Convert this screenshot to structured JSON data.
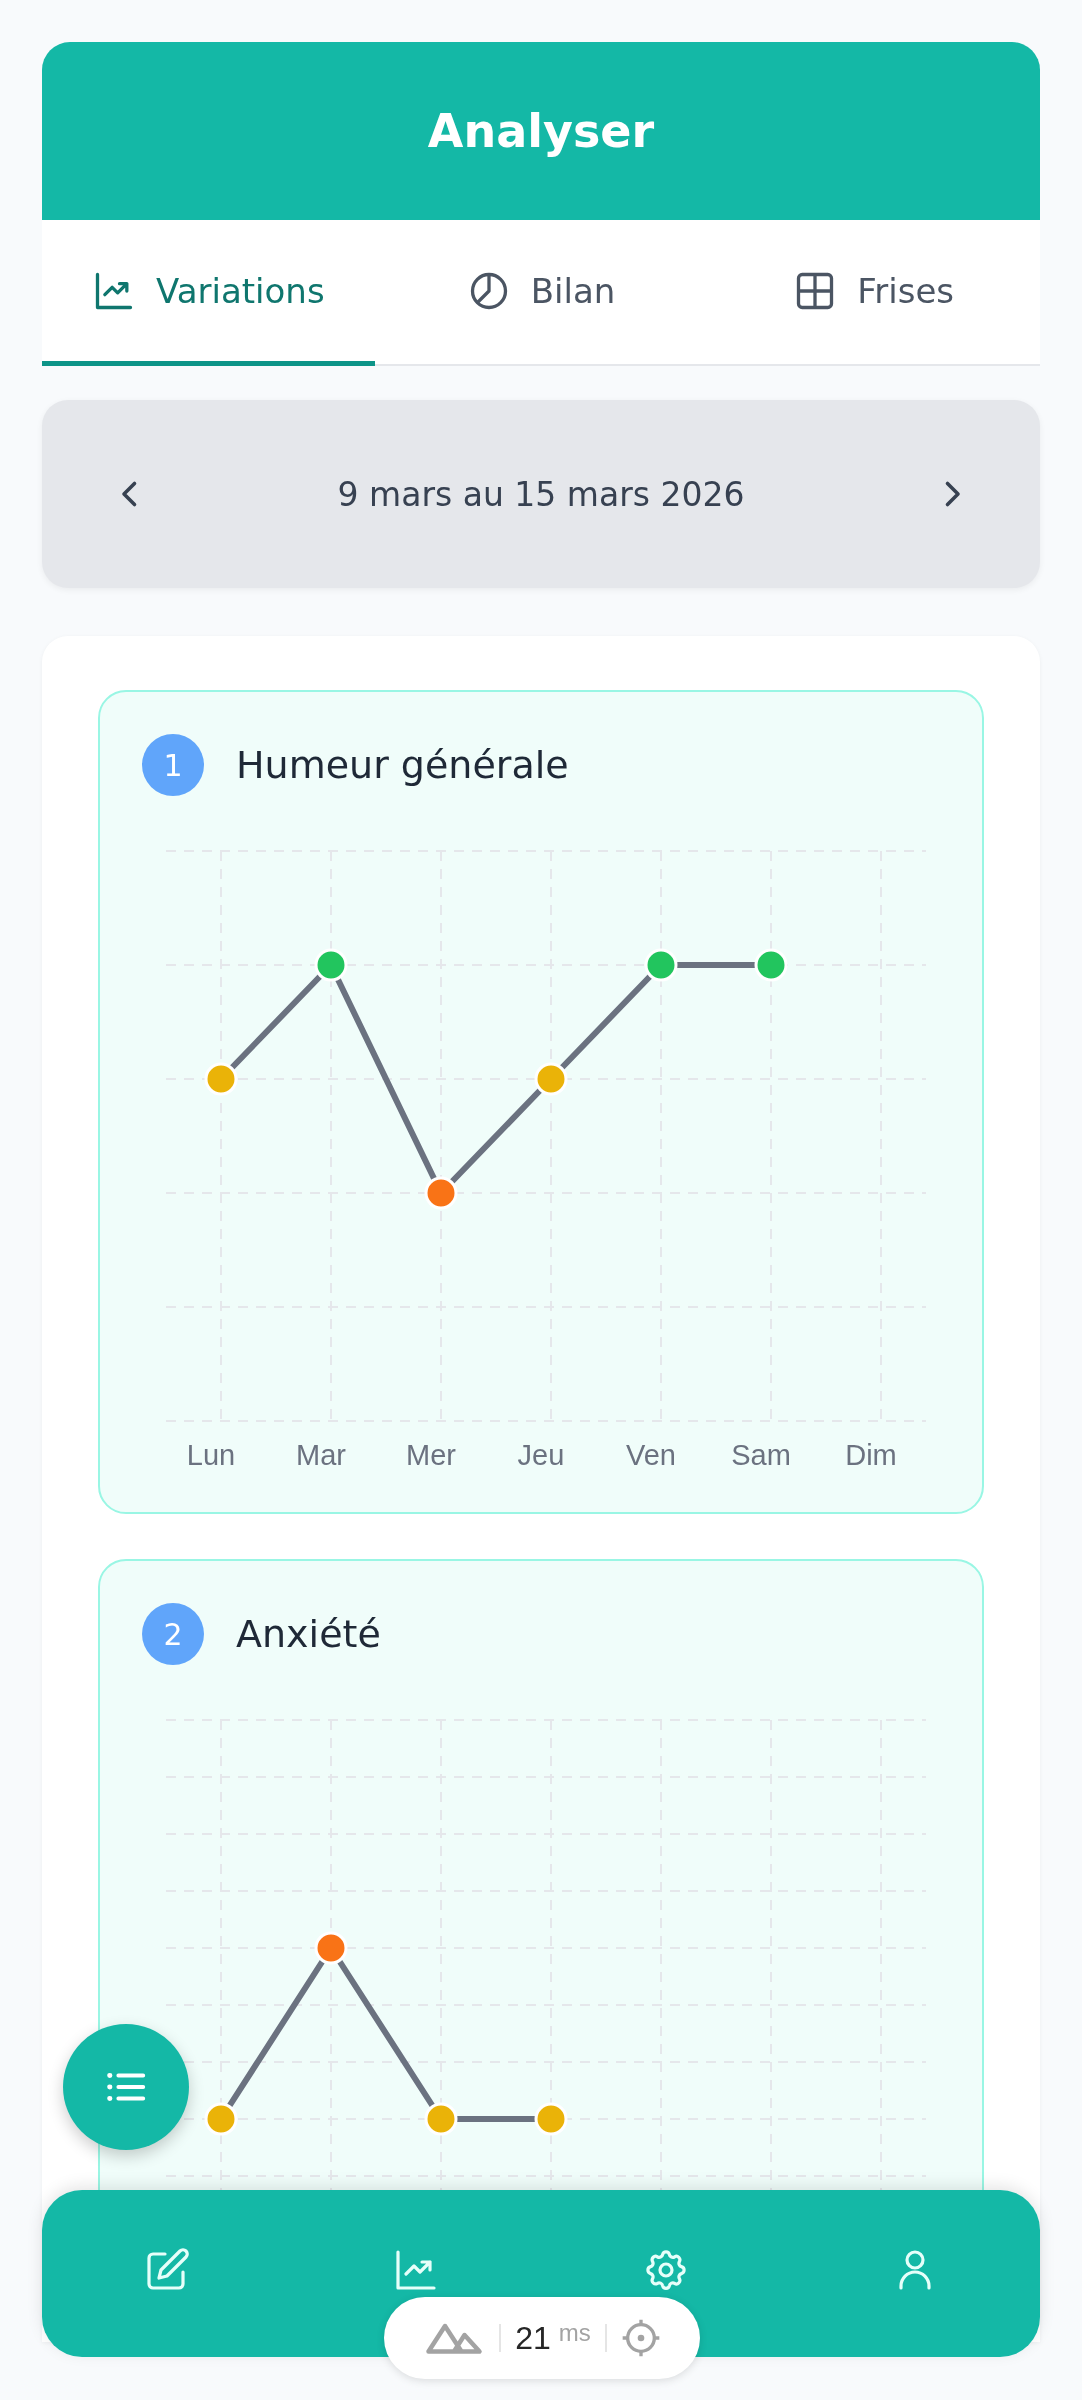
{
  "header": {
    "title": "Analyser"
  },
  "tabs": [
    {
      "label": "Variations",
      "selected": true
    },
    {
      "label": "Bilan",
      "selected": false
    },
    {
      "label": "Frises",
      "selected": false
    }
  ],
  "week": {
    "label": "9 mars au 15 mars 2026"
  },
  "charts": [
    {
      "number": "1",
      "title": "Humeur générale",
      "days": [
        "Lun",
        "Mar",
        "Mer",
        "Jeu",
        "Ven",
        "Sam",
        "Dim"
      ],
      "points": [
        {
          "color": "#eab308"
        },
        {
          "color": "#22c55e"
        },
        {
          "color": "#f97316"
        },
        {
          "color": "#eab308"
        },
        {
          "color": "#22c55e"
        },
        {
          "color": "#22c55e"
        }
      ]
    },
    {
      "number": "2",
      "title": "Anxiété",
      "points": [
        {
          "color": "#eab308"
        },
        {
          "color": "#f97316"
        },
        {
          "color": "#eab308"
        },
        {
          "color": "#eab308"
        }
      ]
    }
  ],
  "dev_badge": {
    "value": "21",
    "unit": "ms"
  }
}
